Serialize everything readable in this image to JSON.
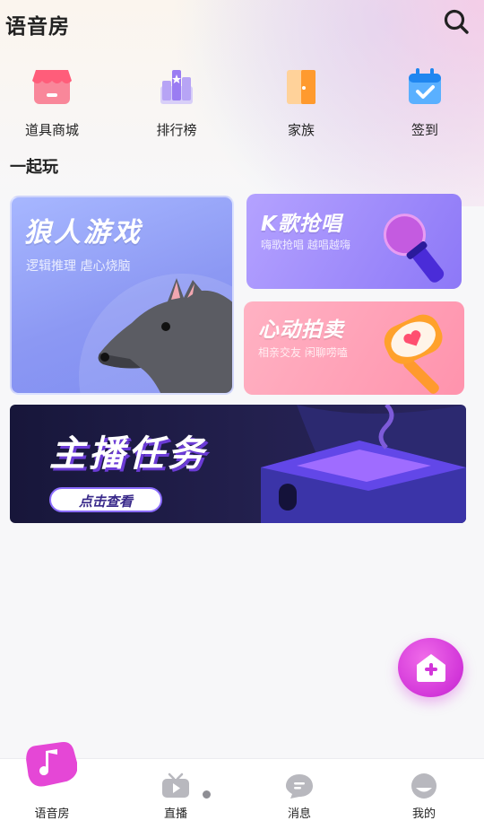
{
  "header": {
    "title": "语音房"
  },
  "quick_links": [
    {
      "label": "道具商城",
      "icon": "shop-icon"
    },
    {
      "label": "排行榜",
      "icon": "ranking-icon"
    },
    {
      "label": "家族",
      "icon": "family-door-icon"
    },
    {
      "label": "签到",
      "icon": "checkin-calendar-icon"
    }
  ],
  "section": {
    "title": "一起玩"
  },
  "cards": {
    "wolf": {
      "title": "狼人游戏",
      "subtitle": "逻辑推理 虐心烧脑"
    },
    "ksong": {
      "title": "K歌抢唱",
      "subtitle": "嗨歌抢唱 越唱越嗨"
    },
    "heart": {
      "title": "心动拍卖",
      "subtitle": "相亲交友 闲聊唠嗑"
    }
  },
  "banner": {
    "title": "主播任务",
    "button": "点击查看"
  },
  "tabs": [
    {
      "label": "语音房",
      "icon": "music-note-icon",
      "active": true
    },
    {
      "label": "直播",
      "icon": "tv-play-icon",
      "active": false
    },
    {
      "label": "消息",
      "icon": "chat-bubble-icon",
      "active": false
    },
    {
      "label": "我的",
      "icon": "profile-icon",
      "active": false
    }
  ],
  "colors": {
    "accent_pink": "#d236d9",
    "wolf_card": "#8c98f3",
    "ksong_card": "#8d78f7",
    "heart_card": "#ff93ad",
    "banner_bg": "#1c1b45"
  }
}
